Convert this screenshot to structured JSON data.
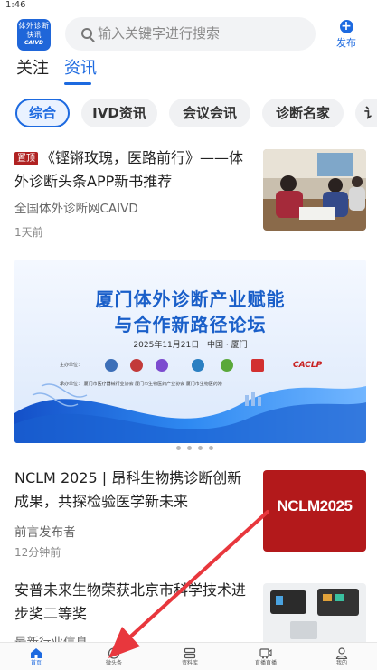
{
  "status_bar": {
    "time": "1:46"
  },
  "header": {
    "logo_line1": "体外诊断",
    "logo_line2": "快讯",
    "logo_line3": "CAIVD",
    "search_placeholder": "输入关键字进行搜索",
    "publish_label": "发布"
  },
  "top_tabs": [
    {
      "label": "关注",
      "active": false
    },
    {
      "label": "资讯",
      "active": true
    }
  ],
  "categories": [
    {
      "label": "综合",
      "active": true
    },
    {
      "label": "IVD资讯",
      "active": false
    },
    {
      "label": "会议会讯",
      "active": false
    },
    {
      "label": "诊断名家",
      "active": false
    },
    {
      "label": "讠",
      "active": false
    }
  ],
  "articles": [
    {
      "badge": "置顶",
      "title": "《铿锵玫瑰，医路前行》——体外诊断头条APP新书推荐",
      "source": "全国体外诊断网CAIVD",
      "time": "1天前"
    },
    {
      "title": "NCLM 2025 | 昂科生物携诊断创新成果，共探检验医学新未来",
      "source": "前言发布者",
      "time": "12分钟前",
      "thumb_text": "NCLM2025"
    },
    {
      "title": "安普未来生物荣获北京市科学技术进步奖二等奖",
      "source": "最新行业信息"
    }
  ],
  "banner": {
    "title_line1": "厦门体外诊断产业赋能",
    "title_line2": "与合作新路径论坛",
    "date": "2025年11月21日  |  中国 · 厦门",
    "sponsor_label": "主办单位：",
    "organizer_text": "承办单位：  厦门市医疗器械行业协会    厦门市生物医药产业协会    厦门市生物医药港",
    "caclp_logo": "CACLP",
    "page_count": 4,
    "active_page": 1
  },
  "bottom_nav": [
    {
      "label": "首页",
      "icon": "home-icon",
      "active": true
    },
    {
      "label": "微头条",
      "icon": "compass-icon",
      "active": false
    },
    {
      "label": "资料库",
      "icon": "library-icon",
      "active": false
    },
    {
      "label": "直播直播",
      "icon": "live-icon",
      "active": false
    },
    {
      "label": "我的",
      "icon": "profile-icon",
      "active": false
    }
  ],
  "colors": {
    "accent": "#1d6ae0",
    "pin_badge": "#b02222",
    "annotation_arrow": "#e8373d"
  }
}
